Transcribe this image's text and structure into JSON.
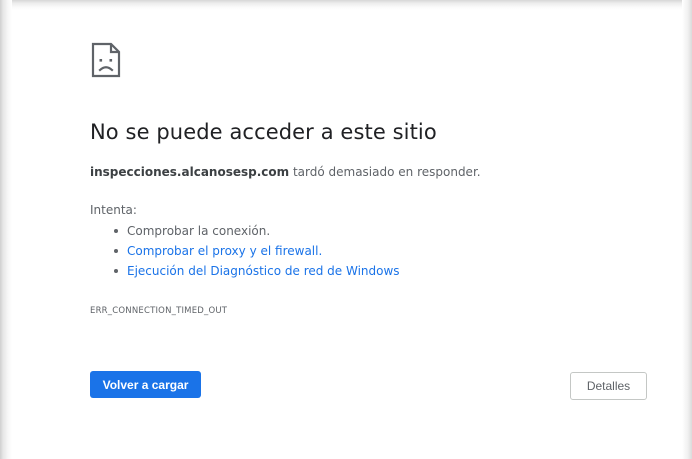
{
  "icon": {
    "name": "sad-page-icon"
  },
  "error": {
    "title": "No se puede acceder a este sitio",
    "host": "inspecciones.alcanosesp.com",
    "summary_suffix": " tardó demasiado en responder.",
    "try_label": "Intenta:",
    "suggestions": [
      {
        "label": "Comprobar la conexión.",
        "is_link": false
      },
      {
        "label": "Comprobar el proxy y el firewall.",
        "is_link": true
      },
      {
        "label": "Ejecución del Diagnóstico de red de Windows",
        "is_link": true
      }
    ],
    "code": "ERR_CONNECTION_TIMED_OUT"
  },
  "buttons": {
    "reload_label": "Volver a cargar",
    "details_label": "Detalles"
  },
  "colors": {
    "accent": "#1a73e8",
    "title_text": "#202124",
    "body_text": "#5f6368",
    "link": "#1a73e8"
  }
}
